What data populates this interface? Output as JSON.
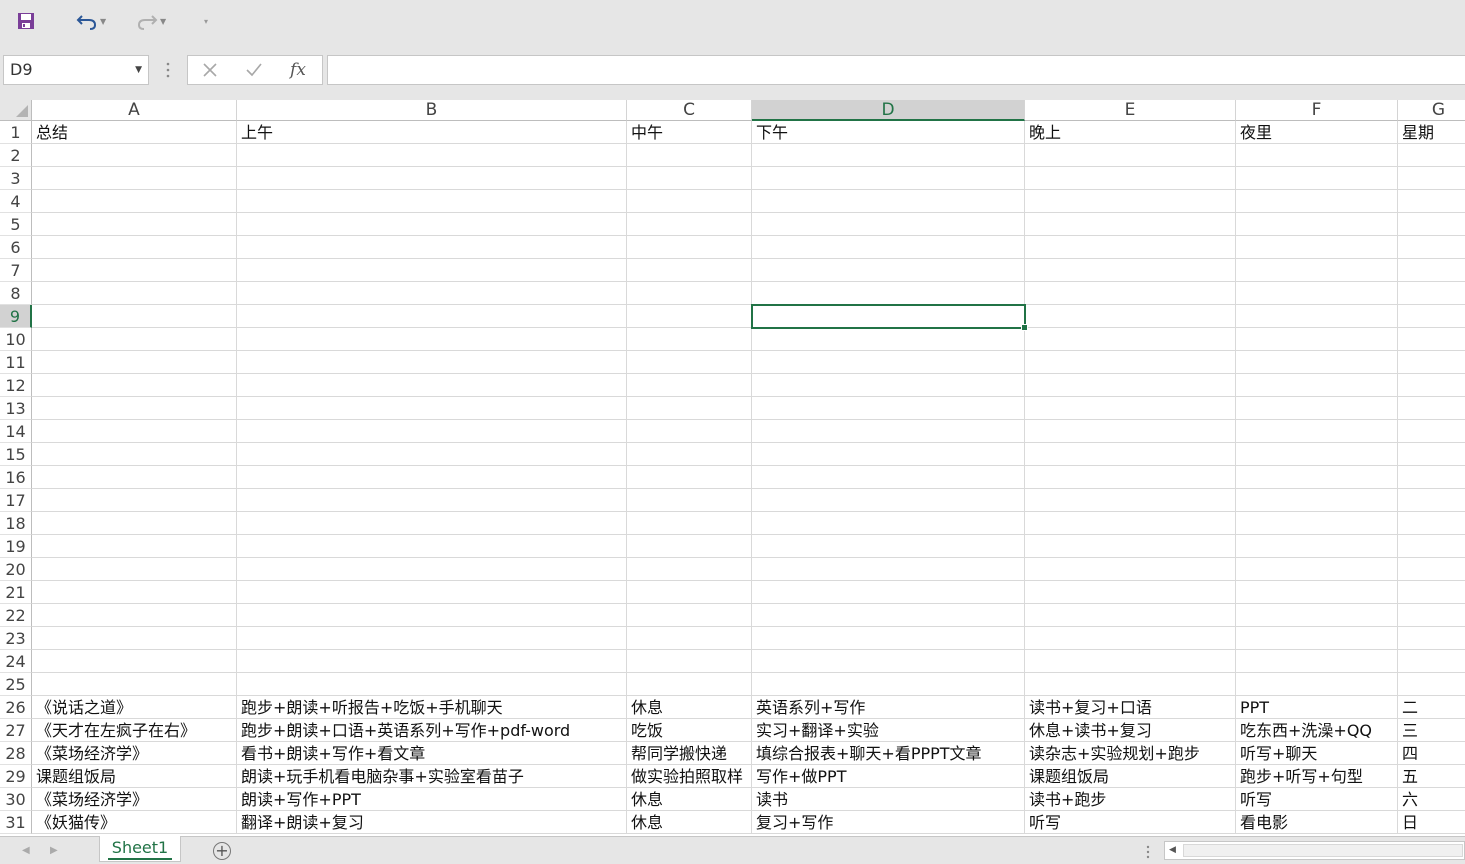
{
  "toolbar": {
    "save_icon": "save-icon",
    "undo_icon": "undo-icon",
    "redo_icon": "redo-icon"
  },
  "formula_bar": {
    "name_box": "D9",
    "cancel_icon": "cancel-icon",
    "enter_icon": "checkmark-icon",
    "function_label": "fx",
    "formula_value": ""
  },
  "columns": [
    "A",
    "B",
    "C",
    "D",
    "E",
    "F",
    "G"
  ],
  "selected_column": "D",
  "selected_row": 9,
  "row_numbers": [
    1,
    2,
    3,
    4,
    5,
    6,
    7,
    8,
    9,
    10,
    11,
    12,
    13,
    14,
    15,
    16,
    17,
    18,
    19,
    20,
    21,
    22,
    23,
    24,
    25,
    26,
    27,
    28,
    29,
    30,
    31
  ],
  "rows": [
    {
      "row": 1,
      "cells": [
        "总结",
        "上午",
        "中午",
        "下午",
        "晚上",
        "夜里",
        "星期"
      ]
    },
    {
      "row": 26,
      "cells": [
        "《说话之道》",
        "跑步+朗读+听报告+吃饭+手机聊天",
        "休息",
        "英语系列+写作",
        "读书+复习+口语",
        "PPT",
        "二"
      ]
    },
    {
      "row": 27,
      "cells": [
        "《天才在左疯子在右》",
        "跑步+朗读+口语+英语系列+写作+pdf-word",
        "吃饭",
        "实习+翻译+实验",
        "休息+读书+复习",
        "吃东西+洗澡+QQ",
        "三"
      ]
    },
    {
      "row": 28,
      "cells": [
        "《菜场经济学》",
        "看书+朗读+写作+看文章",
        "帮同学搬快递",
        "填综合报表+聊天+看PPPT文章",
        "读杂志+实验规划+跑步",
        "听写+聊天",
        "四"
      ]
    },
    {
      "row": 29,
      "cells": [
        "课题组饭局",
        "朗读+玩手机看电脑杂事+实验室看苗子",
        "做实验拍照取样",
        "写作+做PPT",
        "课题组饭局",
        "跑步+听写+句型",
        "五"
      ]
    },
    {
      "row": 30,
      "cells": [
        "《菜场经济学》",
        "朗读+写作+PPT",
        "休息",
        "读书",
        "读书+跑步",
        "听写",
        "六"
      ]
    },
    {
      "row": 31,
      "cells": [
        "《妖猫传》",
        "翻译+朗读+复习",
        "休息",
        "复习+写作",
        "听写",
        "看电影",
        "日"
      ]
    }
  ],
  "sheet_tabs": [
    {
      "label": "Sheet1",
      "active": true
    }
  ],
  "accent_color": "#217346"
}
